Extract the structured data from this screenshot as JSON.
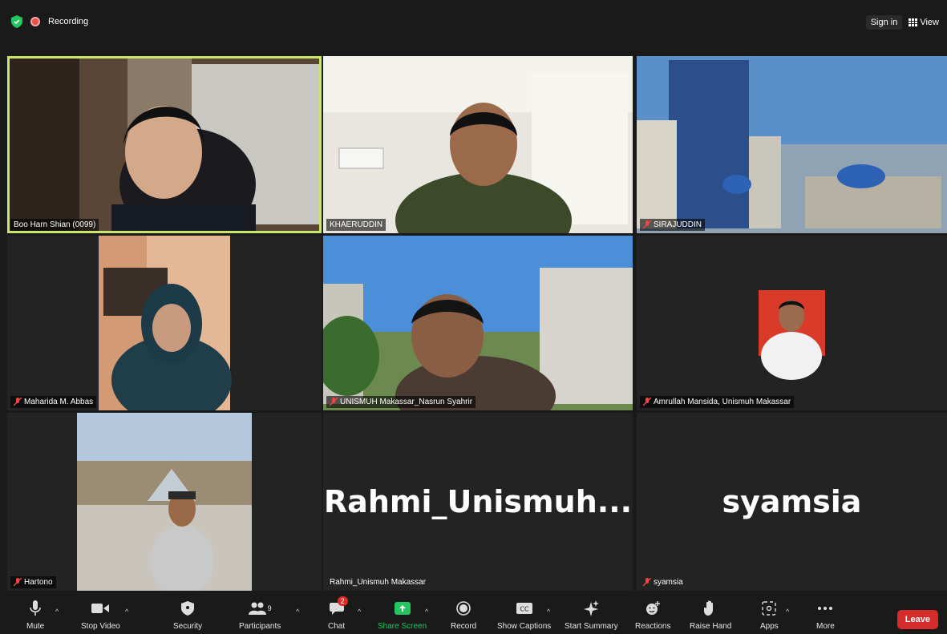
{
  "topbar": {
    "recording_label": "Recording",
    "signin_label": "Sign in",
    "view_label": "View"
  },
  "participants": [
    {
      "name": "Boo Harn Shian (0099)",
      "muted": false,
      "active": true
    },
    {
      "name": "KHAERUDDIN",
      "muted": false
    },
    {
      "name": "SIRAJUDDIN",
      "muted": true
    },
    {
      "name": "Maharida M. Abbas",
      "muted": true
    },
    {
      "name": "UNISMUH Makassar_Nasrun Syahrir",
      "muted": true
    },
    {
      "name": "Amrullah Mansida, Unismuh Makassar",
      "muted": true
    },
    {
      "name": "Hartono",
      "muted": true
    },
    {
      "name": "Rahmi_Unismuh Makassar",
      "muted": false,
      "display": "Rahmi_Unismuh..."
    },
    {
      "name": "syamsia",
      "muted": true,
      "display": "syamsia"
    }
  ],
  "toolbar": {
    "mute": "Mute",
    "stop_video": "Stop Video",
    "security": "Security",
    "participants": "Participants",
    "participants_count": "9",
    "chat": "Chat",
    "chat_badge": "2",
    "share_screen": "Share Screen",
    "record": "Record",
    "show_captions": "Show Captions",
    "start_summary": "Start Summary",
    "reactions": "Reactions",
    "raise_hand": "Raise Hand",
    "apps": "Apps",
    "more": "More",
    "leave": "Leave"
  },
  "colors": {
    "accent_green": "#22c55e",
    "active_border": "#cbe56b",
    "leave_red": "#d42b2b"
  }
}
